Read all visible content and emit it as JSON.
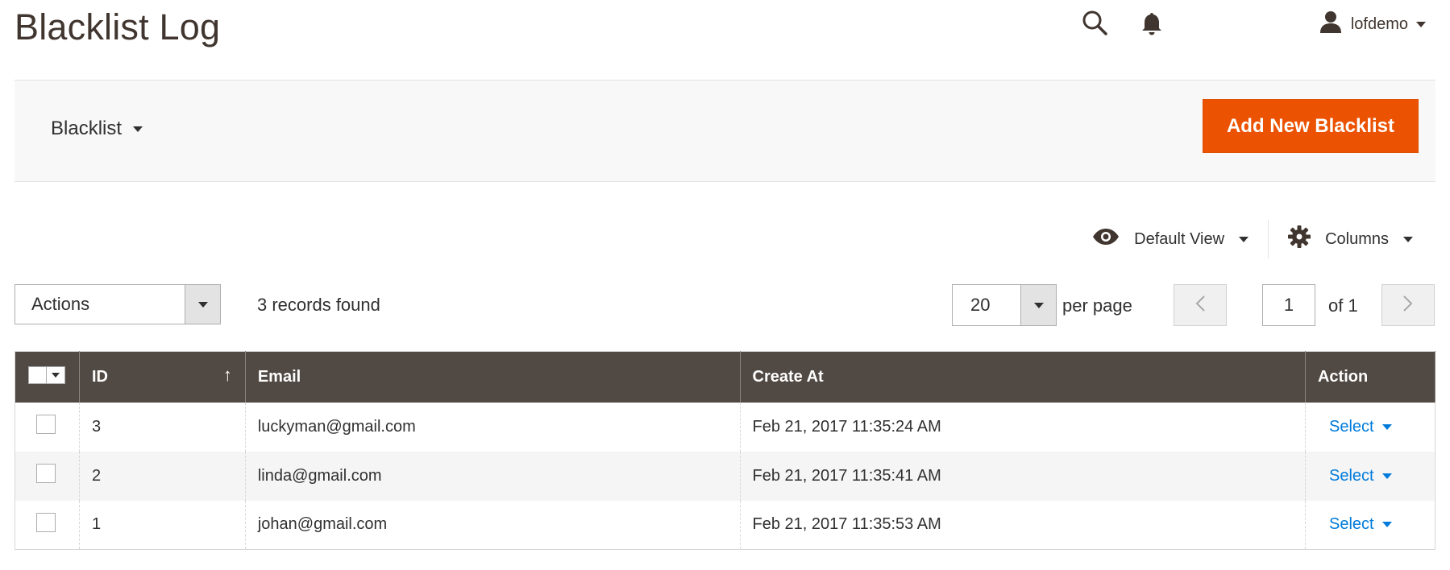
{
  "page": {
    "title": "Blacklist Log"
  },
  "header": {
    "search_icon": "search-icon",
    "notifications_icon": "bell-icon",
    "user": {
      "name": "lofdemo",
      "icon": "user-icon"
    }
  },
  "action_bar": {
    "store_switcher_label": "Blacklist",
    "primary_button_label": "Add New Blacklist",
    "primary_color": "#eb5202"
  },
  "view_controls": {
    "default_view_label": "Default View",
    "columns_label": "Columns"
  },
  "toolbar": {
    "actions_label": "Actions",
    "records_found": "3 records found",
    "per_page_value": "20",
    "per_page_label": "per page",
    "current_page": "1",
    "total_pages_label": "of 1"
  },
  "grid": {
    "header_color": "#514943",
    "columns": [
      "ID",
      "Email",
      "Create At",
      "Action"
    ],
    "sort_indicator": "↑",
    "rows": [
      {
        "id": "3",
        "email": "luckyman@gmail.com",
        "created": "Feb 21, 2017 11:35:24 AM",
        "action": "Select"
      },
      {
        "id": "2",
        "email": "linda@gmail.com",
        "created": "Feb 21, 2017 11:35:41 AM",
        "action": "Select"
      },
      {
        "id": "1",
        "email": "johan@gmail.com",
        "created": "Feb 21, 2017 11:35:53 AM",
        "action": "Select"
      }
    ],
    "link_color": "#007bdb"
  }
}
